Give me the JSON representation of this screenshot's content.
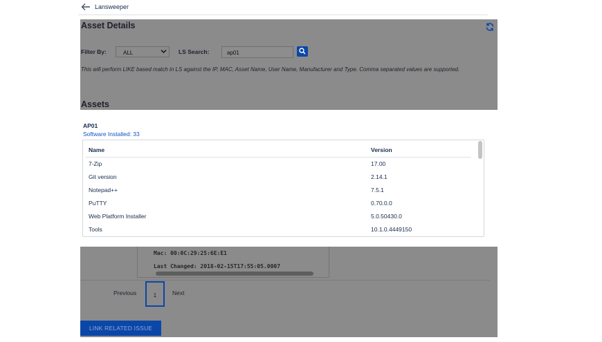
{
  "app": {
    "title": "Lansweeper"
  },
  "asset_details": {
    "title": "Asset Details",
    "filter_label": "Filter By:",
    "filter_value": "ALL",
    "ls_search_label": "LS Search:",
    "ls_search_value": "ap01",
    "description": "This will perform LIKE based match in LS against the IP, MAC, Asset Name, User Name, Manufacturer and Type. Comma separated values are supported.",
    "assets_heading": "Assets"
  },
  "popup": {
    "asset_name": "AP01",
    "software_installed": "Software Installed: 33",
    "columns": {
      "name": "Name",
      "version": "Version"
    },
    "rows": [
      {
        "name": "7-Zip",
        "version": "17.00"
      },
      {
        "name": "Git version",
        "version": "2.14.1"
      },
      {
        "name": "Notepad++",
        "version": "7.5.1"
      },
      {
        "name": "PuTTY",
        "version": "0.70.0.0"
      },
      {
        "name": "Web Platform Installer",
        "version": "5.0.50430.0"
      },
      {
        "name": "Tools",
        "version": "10.1.0.4449150"
      }
    ]
  },
  "background_details": {
    "mac_line": "Mac: 00:0C:29:25:6E:E1",
    "changed_line": "Last Changed: 2018-02-15T17:55:05.0007"
  },
  "pagination": {
    "previous": "Previous",
    "page": "1",
    "next": "Next"
  },
  "actions": {
    "link_related_issue": "LINK RELATED ISSUE"
  },
  "colors": {
    "accent": "#0b47a8",
    "link": "#0b55c5",
    "overlay": "#8b8b8b"
  },
  "icons": {
    "back": "arrow-left-icon",
    "refresh": "refresh-icon",
    "search": "search-icon",
    "chevron": "chevron-down-icon"
  }
}
